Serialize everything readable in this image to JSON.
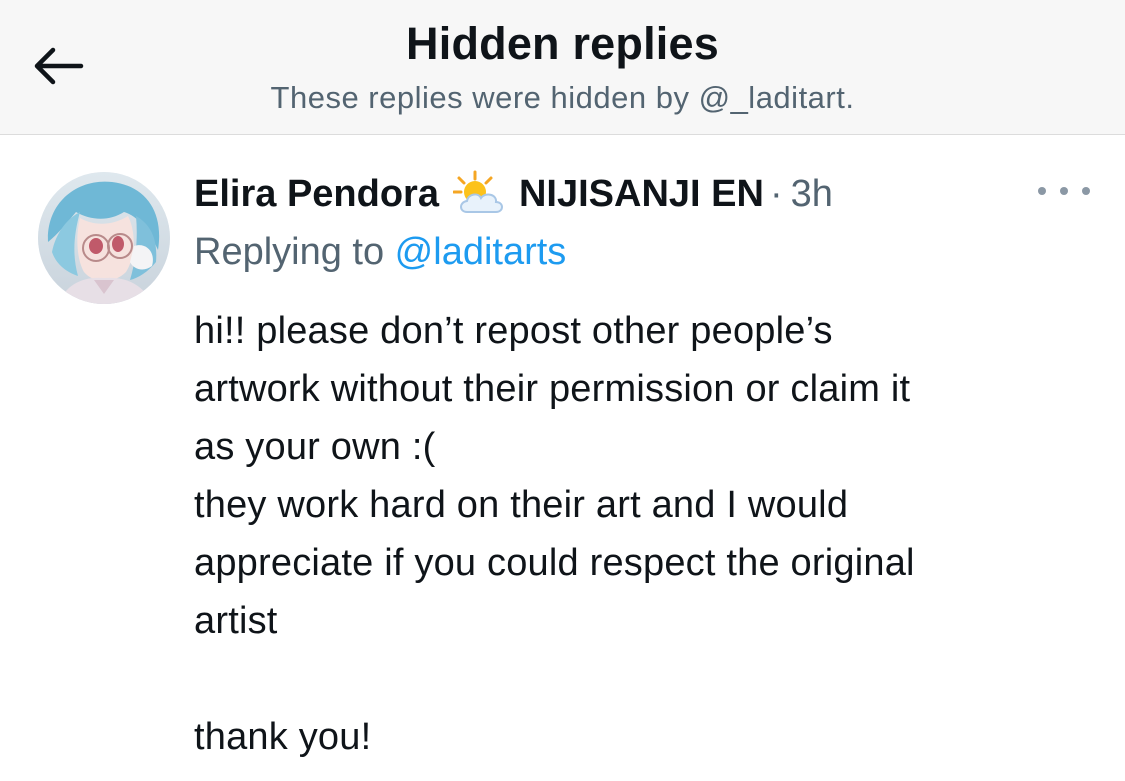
{
  "header": {
    "back_icon": "arrow-left-icon",
    "title": "Hidden replies",
    "subtitle": "These replies were hidden by @_laditart."
  },
  "tweet": {
    "display_name": "Elira Pendora",
    "emoji": "sun-behind-cloud-emoji",
    "affiliation": "NIJISANJI EN",
    "separator": "·",
    "time": "3h",
    "more_icon": "more-options-icon",
    "replying_to_prefix": "Replying to ",
    "replying_to_handle": "@laditarts",
    "text": "hi!! please don’t repost other people’s\nartwork without their permission or claim it\nas your own :(\nthey work hard on their art and I would\nappreciate if you could respect the original\nartist\n\nthank you!"
  },
  "colors": {
    "header_bg": "#f7f7f7",
    "link": "#1d9bf0",
    "muted": "#536471",
    "text": "#0f1419"
  }
}
